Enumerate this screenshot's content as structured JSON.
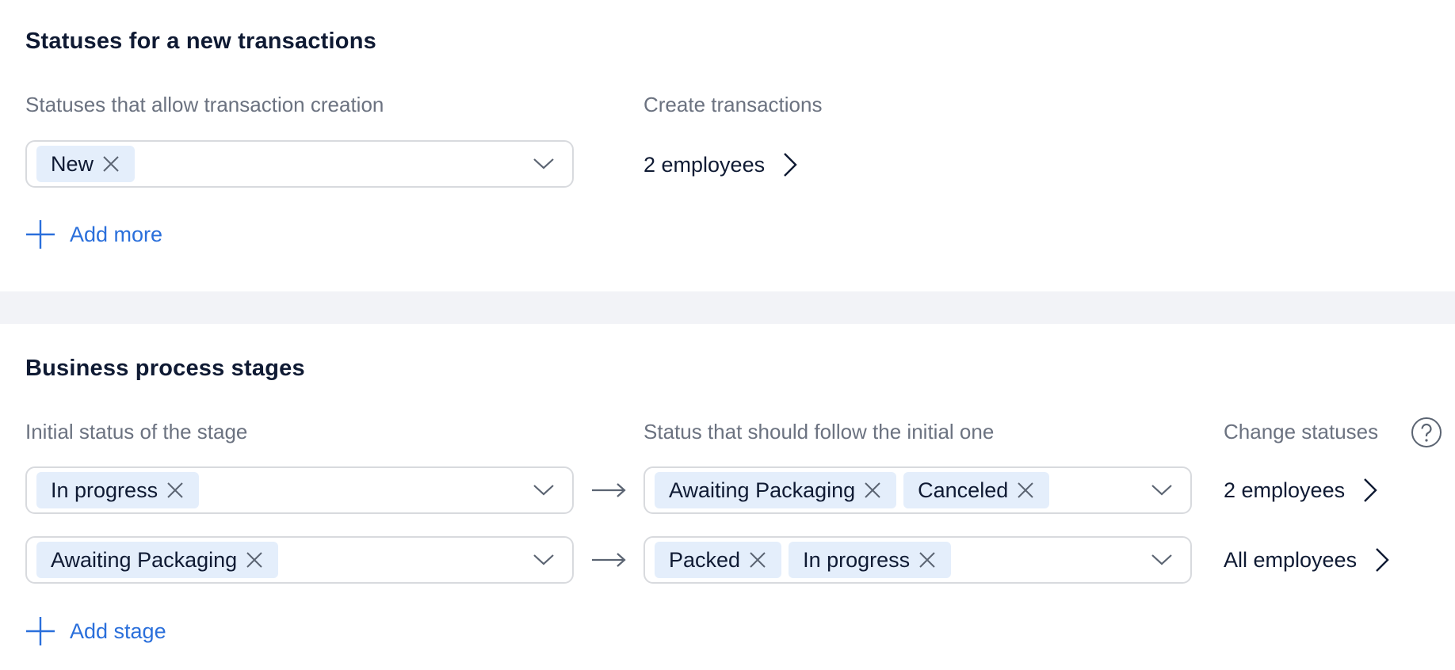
{
  "new_transactions": {
    "title": "Statuses for a new transactions",
    "statuses_label": "Statuses that allow transaction creation",
    "create_label": "Create transactions",
    "selected_statuses": [
      "New"
    ],
    "employees_link": "2 employees",
    "add_more": "Add more"
  },
  "stages": {
    "title": "Business process stages",
    "initial_label": "Initial status of the stage",
    "follow_label": "Status that should follow the initial one",
    "change_label": "Change statuses",
    "rows": [
      {
        "initial": [
          "In progress"
        ],
        "follow": [
          "Awaiting Packaging",
          "Canceled"
        ],
        "employees": "2 employees"
      },
      {
        "initial": [
          "Awaiting Packaging"
        ],
        "follow": [
          "Packed",
          "In progress"
        ],
        "employees": "All employees"
      }
    ],
    "add_stage": "Add stage"
  },
  "colors": {
    "accent": "#2a6fdb",
    "chip_bg": "#e4eefb",
    "divider": "#f2f3f7"
  }
}
